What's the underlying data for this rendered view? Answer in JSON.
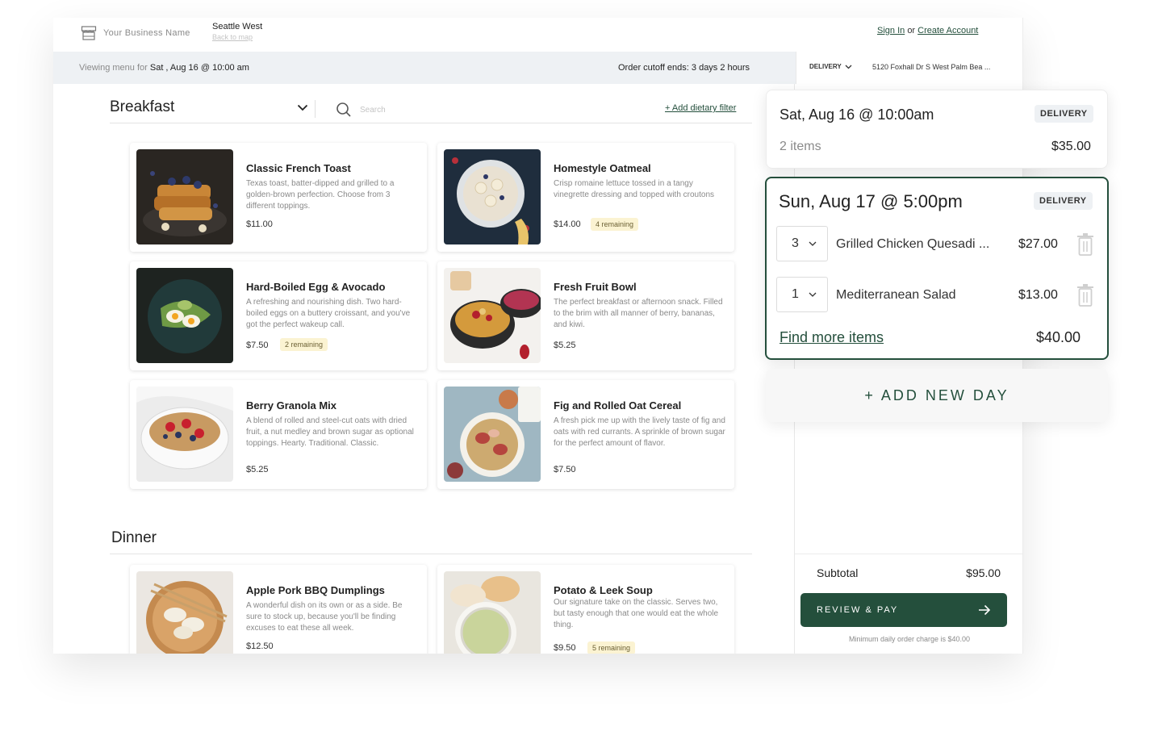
{
  "header": {
    "business_name": "Your Business Name",
    "location_name": "Seattle West",
    "back_to_map": "Back to map",
    "sign_in": "Sign In",
    "auth_or": "or",
    "create_account": "Create Account"
  },
  "info_bar": {
    "viewing_prefix": "Viewing menu for",
    "viewing_date": "Sat , Aug 16 @ 10:00 am",
    "cutoff": "Order cutoff ends: 3 days 2 hours"
  },
  "address_bar": {
    "mode": "DELIVERY",
    "address": "5120 Foxhall Dr S West Palm Bea ..."
  },
  "menu": {
    "category_select": "Breakfast",
    "search_placeholder": "Search",
    "dietary_filter": "+ Add dietary filter",
    "breakfast": [
      {
        "name": "Classic French Toast",
        "desc": "Texas toast, batter-dipped and grilled to a golden-brown perfection. Choose from 3 different toppings.",
        "price": "$11.00",
        "remaining": ""
      },
      {
        "name": "Homestyle Oatmeal",
        "desc": "Crisp romaine lettuce tossed in a tangy vinegrette dressing and topped with croutons",
        "price": "$14.00",
        "remaining": "4 remaining"
      },
      {
        "name": "Hard-Boiled Egg & Avocado",
        "desc": "A refreshing and nourishing dish. Two hard-boiled eggs on a buttery croissant, and you've got the perfect wakeup call.",
        "price": "$7.50",
        "remaining": "2 remaining"
      },
      {
        "name": "Fresh Fruit Bowl",
        "desc": "The perfect breakfast or afternoon snack. Filled to the brim with all manner of berry, bananas, and kiwi.",
        "price": "$5.25",
        "remaining": ""
      },
      {
        "name": "Berry Granola Mix",
        "desc": "A blend of rolled and steel-cut oats with dried fruit, a nut medley and brown sugar as optional toppings. Hearty. Traditional. Classic.",
        "price": "$5.25",
        "remaining": ""
      },
      {
        "name": "Fig and Rolled Oat Cereal",
        "desc": "A fresh pick me up with the lively taste of fig and oats with red currants. A sprinkle of brown sugar for the perfect amount of flavor.",
        "price": "$7.50",
        "remaining": ""
      }
    ],
    "dinner_title": "Dinner",
    "dinner": [
      {
        "name": "Apple Pork BBQ Dumplings",
        "desc": "A wonderful dish on its own or as a side. Be sure to stock up, because you'll be finding excuses to eat these all week.",
        "price": "$12.50",
        "remaining": ""
      },
      {
        "name": "Potato & Leek Soup",
        "desc": "Our signature take on the classic. Serves two, but tasty enough that one would eat the whole thing.",
        "price": "$9.50",
        "remaining": "5 remaining"
      }
    ]
  },
  "order": {
    "day1": {
      "title": "Sat, Aug 16 @ 10:00am",
      "badge": "DELIVERY",
      "items": "2 items",
      "total": "$35.00"
    },
    "day2": {
      "title": "Sun, Aug 17 @ 5:00pm",
      "badge": "DELIVERY",
      "lines": [
        {
          "qty": "3",
          "name": "Grilled Chicken Quesadi ...",
          "price": "$27.00"
        },
        {
          "qty": "1",
          "name": "Mediterranean Salad",
          "price": "$13.00"
        }
      ],
      "find_more": "Find more items",
      "total": "$40.00"
    },
    "add_new_day": "+ ADD NEW DAY",
    "subtotal_label": "Subtotal",
    "subtotal_value": "$95.00",
    "review_pay": "REVIEW & PAY",
    "min_note": "Minimum daily order charge is $40.00"
  },
  "colors": {
    "accent": "#244f3c",
    "badge_bg": "#fbf3d2",
    "info_bar_bg": "#eef1f4"
  },
  "icons": [
    "storefront-icon",
    "chevron-down-icon",
    "search-icon",
    "trash-icon",
    "arrow-right-icon"
  ]
}
